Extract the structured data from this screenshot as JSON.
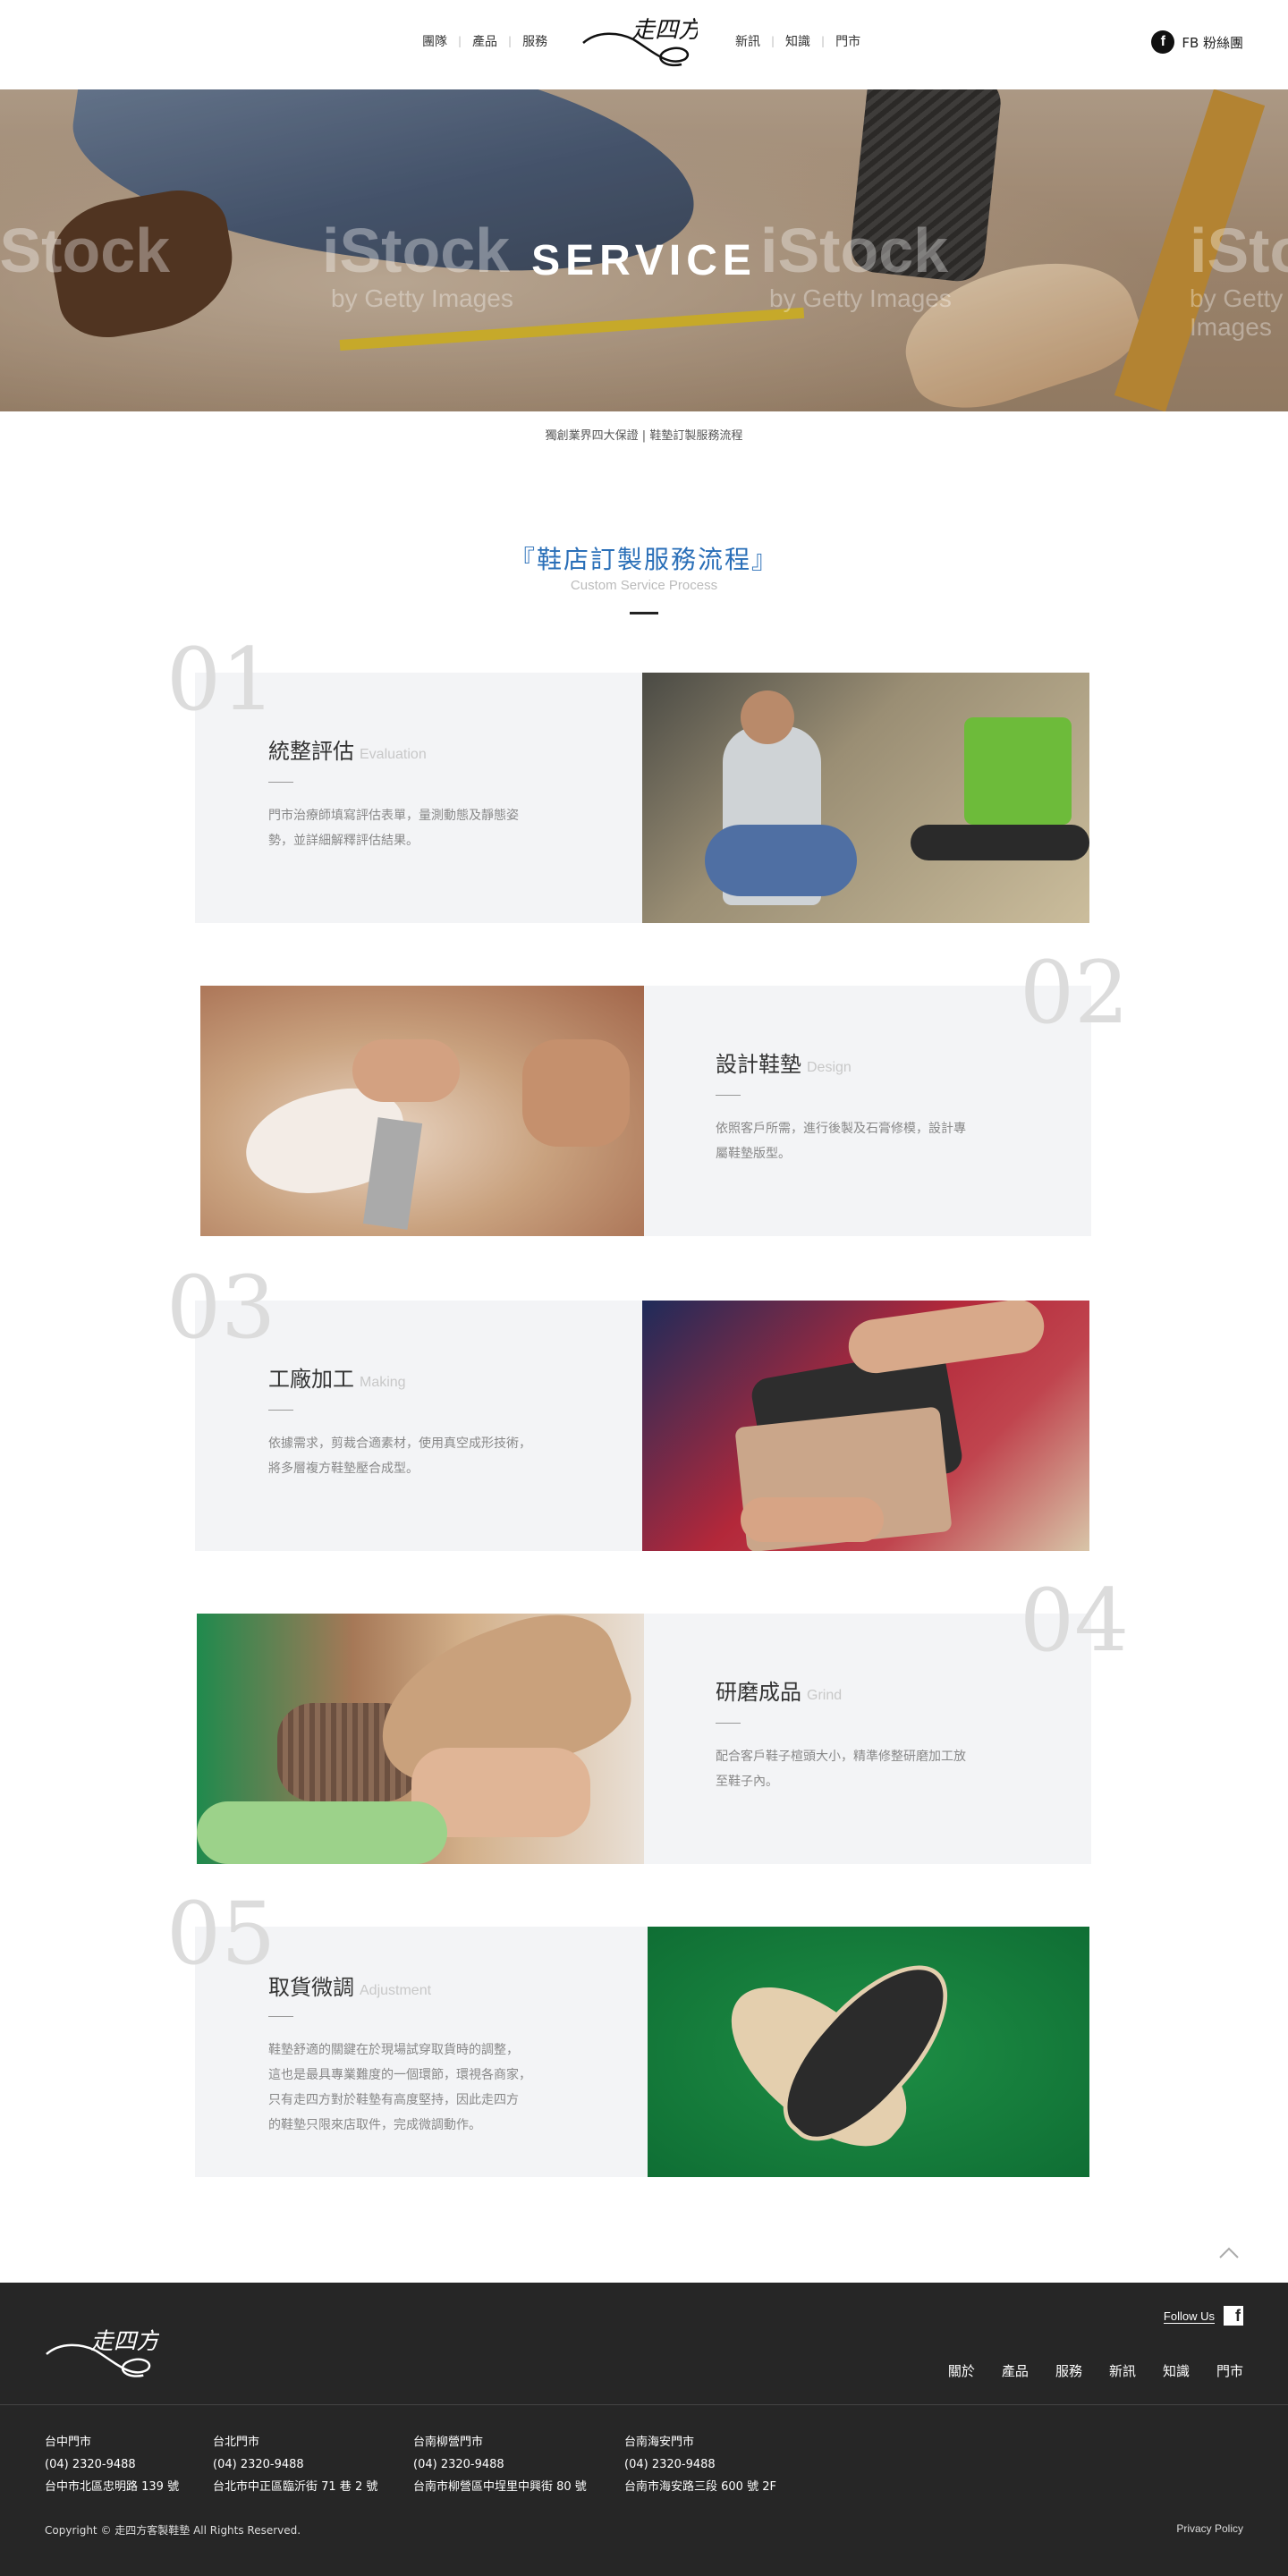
{
  "header": {
    "nav_left": [
      "團隊",
      "產品",
      "服務"
    ],
    "nav_right": [
      "新訊",
      "知識",
      "門市"
    ],
    "logo_text": "走四方",
    "fb_label": "FB 粉絲團"
  },
  "hero": {
    "title": "SERVICE",
    "watermark": "iStock",
    "watermark_sub": "by Getty Images"
  },
  "breadcrumb": "獨創業界四大保證 | 鞋墊訂製服務流程",
  "section": {
    "title": "『鞋店訂製服務流程』",
    "subtitle": "Custom Service Process"
  },
  "steps": [
    {
      "num": "01",
      "title": "統整評估",
      "en": "Evaluation",
      "desc": [
        "門市治療師填寫評估表單，量測動態及靜態姿",
        "勢，並詳細解釋評估結果。"
      ]
    },
    {
      "num": "02",
      "title": "設計鞋墊",
      "en": "Design",
      "desc": [
        "依照客戶所需，進行後製及石膏修模，設計專",
        "屬鞋墊版型。"
      ]
    },
    {
      "num": "03",
      "title": "工廠加工",
      "en": "Making",
      "desc": [
        "依據需求，剪裁合適素材，使用真空成形技術，",
        "將多層複方鞋墊壓合成型。"
      ]
    },
    {
      "num": "04",
      "title": "研磨成品",
      "en": "Grind",
      "desc": [
        "配合客戶鞋子楦頭大小，精準修整研磨加工放",
        "至鞋子內。"
      ]
    },
    {
      "num": "05",
      "title": "取貨微調",
      "en": "Adjustment",
      "desc": [
        "鞋墊舒適的關鍵在於現場試穿取貨時的調整，",
        "這也是最具專業難度的一個環節，環視各商家，",
        "只有走四方對於鞋墊有高度堅持，因此走四方",
        "的鞋墊只限來店取件，完成微調動作。"
      ]
    }
  ],
  "footer": {
    "logo_text": "走四方",
    "follow_label": "Follow Us",
    "fb_icon": "f",
    "nav": [
      "關於",
      "產品",
      "服務",
      "新訊",
      "知識",
      "門市"
    ],
    "stores": [
      {
        "name": "台中門市",
        "phone": "(04) 2320-9488",
        "address": "台中市北區忠明路 139 號"
      },
      {
        "name": "台北門市",
        "phone": "(04) 2320-9488",
        "address": "台北市中正區臨沂街 71 巷 2 號"
      },
      {
        "name": "台南柳營門市",
        "phone": "(04) 2320-9488",
        "address": "台南市柳營區中埕里中興街 80 號"
      },
      {
        "name": "台南海安門市",
        "phone": "(04) 2320-9488",
        "address": "台南市海安路三段 600 號 2F"
      }
    ],
    "copyright": "Copyright © 走四方客製鞋墊 All Rights Reserved.",
    "privacy": "Privacy Policy"
  }
}
